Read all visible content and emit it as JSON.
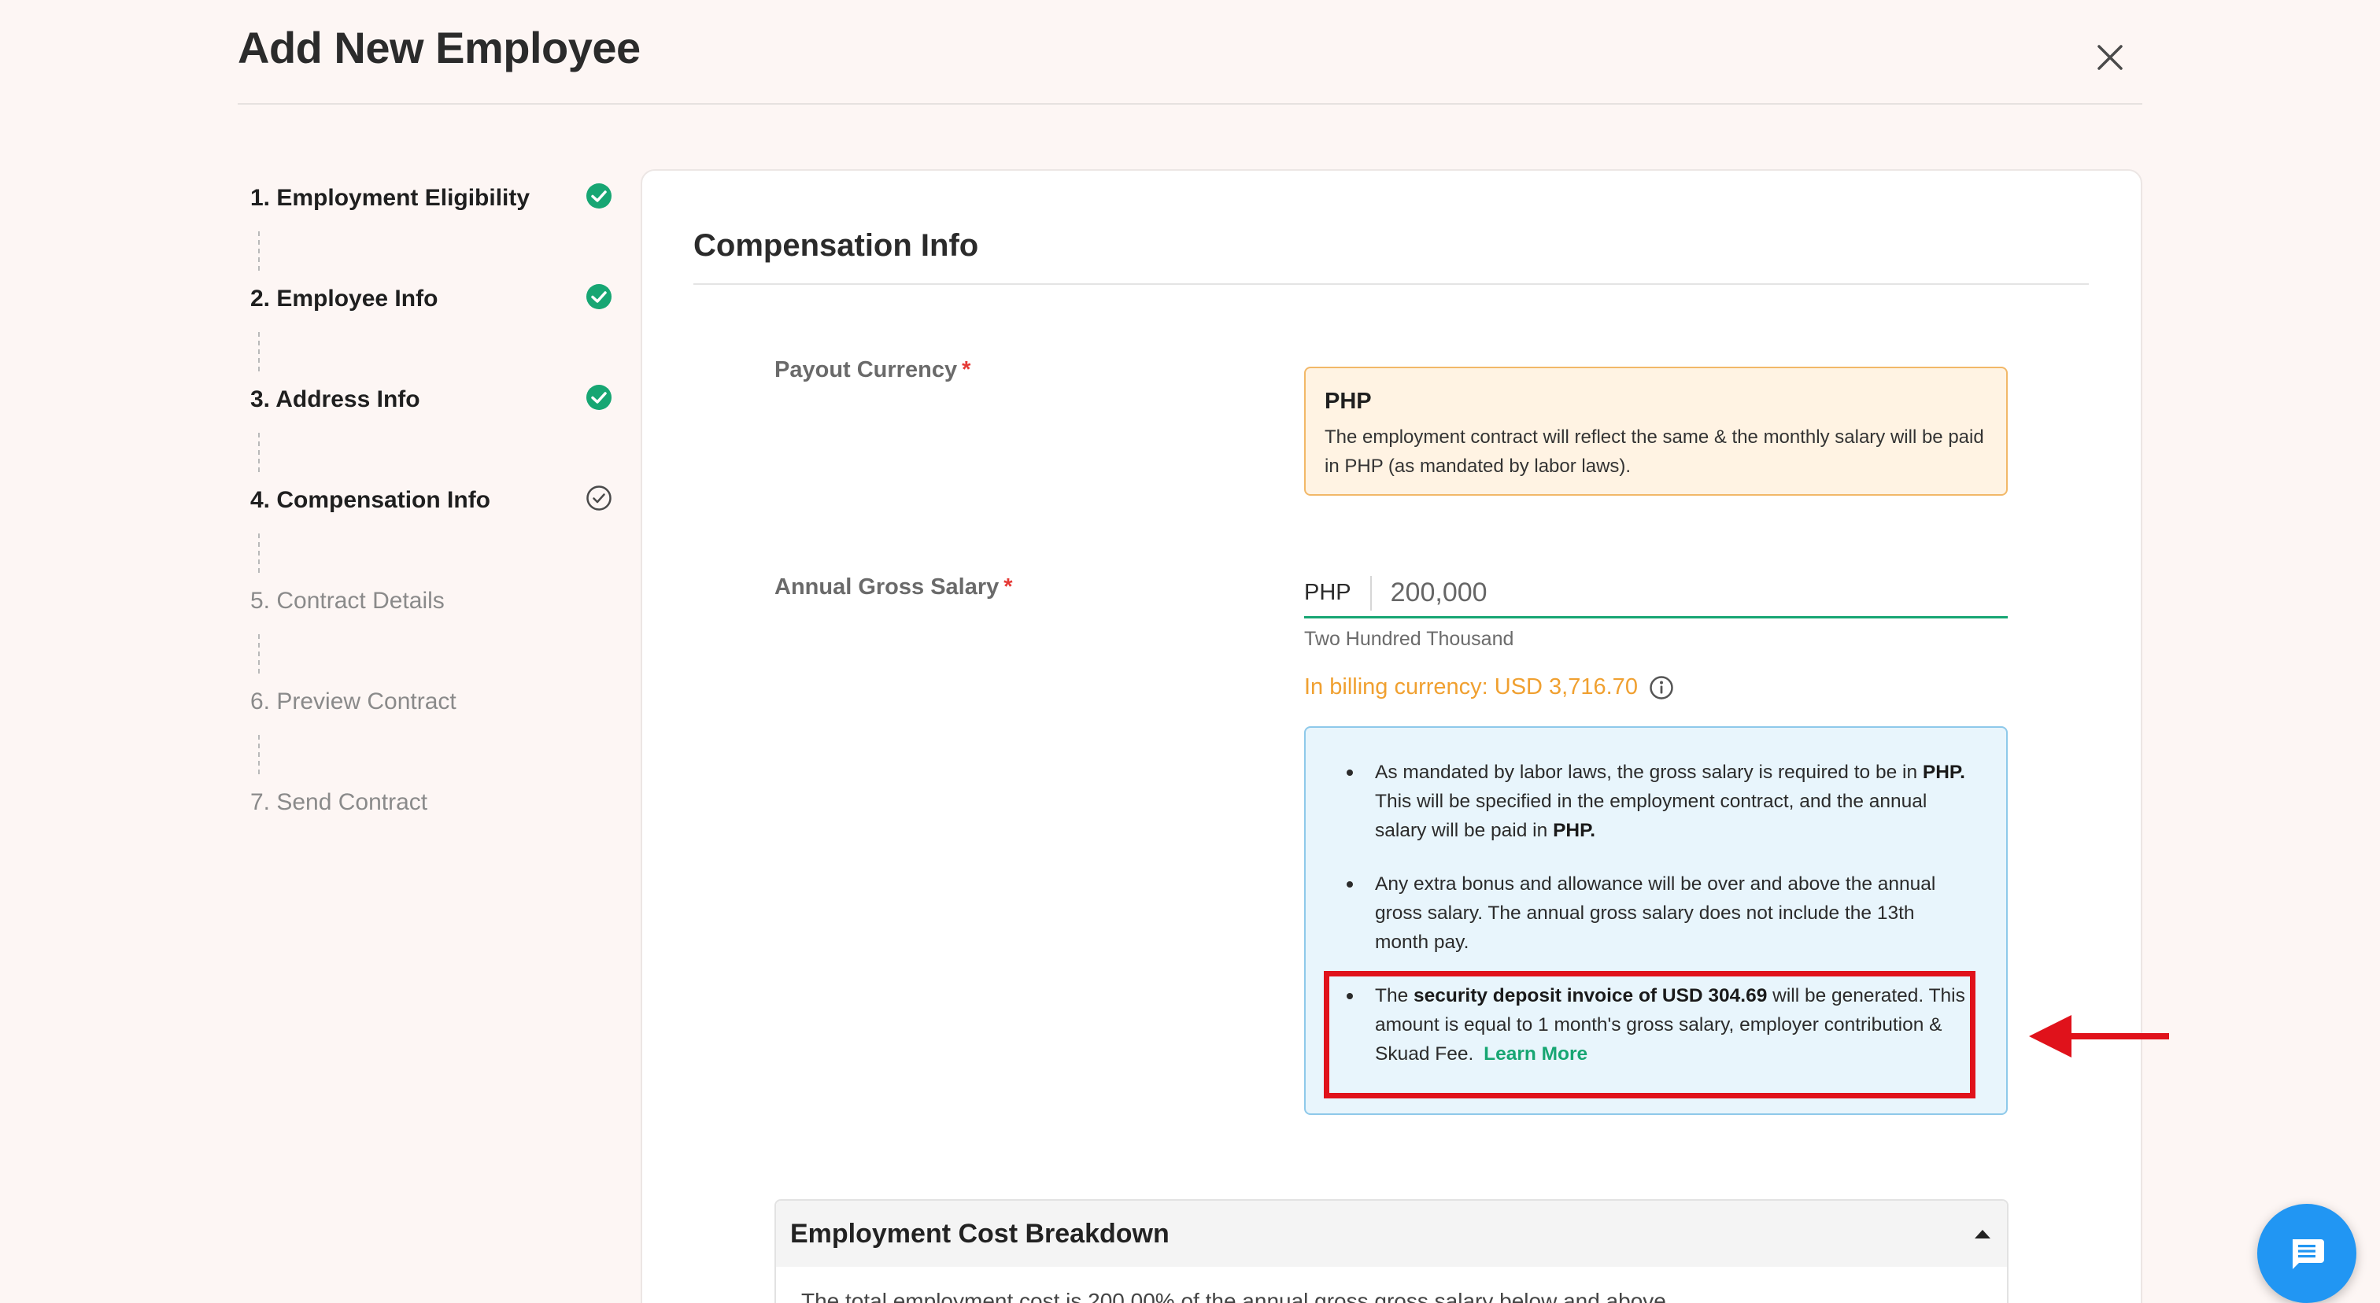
{
  "header": {
    "title": "Add New Employee"
  },
  "steps": [
    {
      "label": "1. Employment Eligibility",
      "status": "completed"
    },
    {
      "label": "2. Employee Info",
      "status": "completed"
    },
    {
      "label": "3. Address Info",
      "status": "completed"
    },
    {
      "label": "4. Compensation Info",
      "status": "current"
    },
    {
      "label": "5. Contract Details",
      "status": "pending"
    },
    {
      "label": "6. Preview Contract",
      "status": "pending"
    },
    {
      "label": "7. Send Contract",
      "status": "pending"
    }
  ],
  "section": {
    "title": "Compensation Info"
  },
  "payout_currency": {
    "label": "Payout Currency",
    "required_mark": "*",
    "code": "PHP",
    "note": "The employment contract will reflect the same & the monthly salary will be paid in PHP (as mandated by labor laws)."
  },
  "annual_salary": {
    "label": "Annual Gross Salary",
    "required_mark": "*",
    "currency_prefix": "PHP",
    "value": "200,000",
    "in_words": "Two Hundred Thousand",
    "billing_line": "In billing currency: USD 3,716.70"
  },
  "info": {
    "item1_a": "As mandated by labor laws, the gross salary is required to be in",
    "item1_b": "PHP.",
    "item1_c": "This will be specified in the employment contract, and the annual salary will be paid in",
    "item1_d": "PHP.",
    "item2": "Any extra bonus and allowance will be over and above the annual gross salary. The annual gross salary does not include the 13th month pay.",
    "item3_a": "The",
    "item3_b": "security deposit invoice of USD 304.69",
    "item3_c": "will be generated. This amount is equal to 1 month's gross salary, employer contribution & Skuad Fee.",
    "learn_more": "Learn More"
  },
  "breakdown": {
    "title": "Employment Cost Breakdown",
    "body": "The total employment cost is 200.00% of the annual gross gross salary below and above"
  },
  "colors": {
    "accent_green": "#17a673",
    "required_red": "#e53935",
    "billing_orange": "#f0a030",
    "highlight_red": "#e0121b",
    "chat_blue": "#2196f3"
  },
  "icons": {
    "close": "close-icon",
    "completed": "check-circle-filled-icon",
    "current": "check-circle-outline-icon",
    "info": "info-icon",
    "collapse": "caret-up-icon",
    "chat": "chat-bubble-icon"
  }
}
